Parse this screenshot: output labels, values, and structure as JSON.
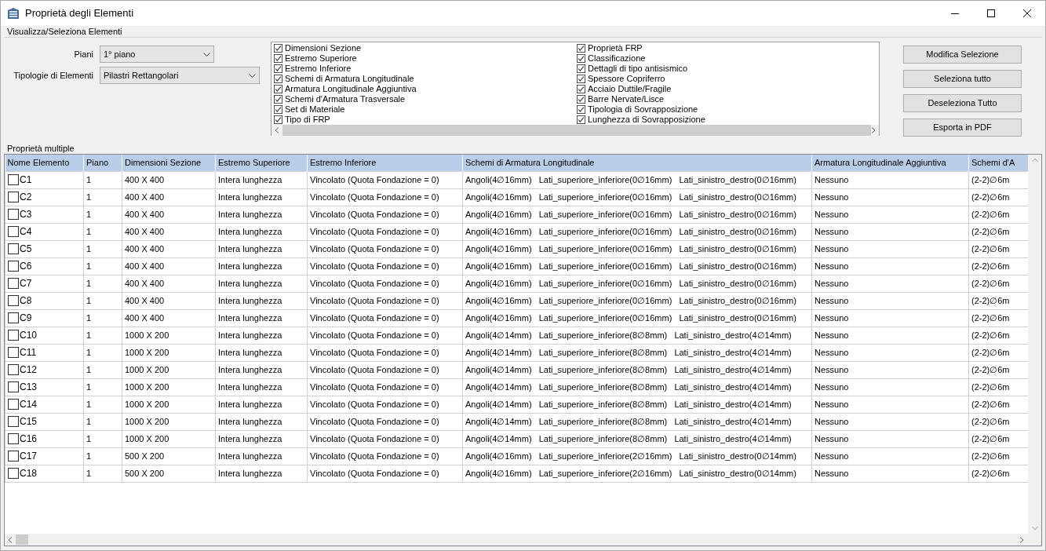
{
  "window": {
    "title": "Proprietà degli Elementi"
  },
  "selection_group": {
    "title": "Visualizza/Seleziona Elementi",
    "fields": [
      {
        "label": "Piani",
        "value": "1° piano"
      },
      {
        "label": "Tipologie di Elementi",
        "value": "Pilastri Rettangolari"
      }
    ],
    "property_checks": [
      {
        "label": "Dimensioni Sezione",
        "checked": true
      },
      {
        "label": "Estremo Superiore",
        "checked": true
      },
      {
        "label": "Estremo Inferiore",
        "checked": true
      },
      {
        "label": "Schemi di Armatura Longitudinale",
        "checked": true
      },
      {
        "label": "Armatura Longitudinale Aggiuntiva",
        "checked": true
      },
      {
        "label": "Schemi d'Armatura Trasversale",
        "checked": true
      },
      {
        "label": "Set di Materiale",
        "checked": true
      },
      {
        "label": "Tipo di FRP",
        "checked": true
      },
      {
        "label": "Proprietà FRP",
        "checked": true
      },
      {
        "label": "Classificazione",
        "checked": true
      },
      {
        "label": "Dettagli di tipo antisismico",
        "checked": true
      },
      {
        "label": "Spessore Copriferro",
        "checked": true
      },
      {
        "label": "Acciaio Duttile/Fragile",
        "checked": true
      },
      {
        "label": "Barre Nervate/Lisce",
        "checked": true
      },
      {
        "label": "Tipologia di Sovrapposizione",
        "checked": true
      },
      {
        "label": "Lunghezza di Sovrapposizione",
        "checked": true
      }
    ],
    "buttons": [
      "Modifica Selezione",
      "Seleziona tutto",
      "Deseleziona Tutto",
      "Esporta in PDF"
    ]
  },
  "table": {
    "title": "Proprietà multiple",
    "columns": [
      "Nome Elemento",
      "Piano",
      "Dimensioni Sezione",
      "Estremo Superiore",
      "Estremo Inferiore",
      "Schemi di Armatura Longitudinale",
      "Armatura Longitudinale Aggiuntiva",
      "Schemi d'A"
    ],
    "rows": [
      {
        "checked": false,
        "cells": [
          "C1",
          "1",
          "400 X 400",
          "Intera lunghezza",
          "Vincolato (Quota Fondazione = 0)",
          "Angoli(4∅16mm)   Lati_superiore_inferiore(0∅16mm)   Lati_sinistro_destro(0∅16mm)",
          "Nessuno",
          "(2-2)∅6m"
        ]
      },
      {
        "checked": false,
        "cells": [
          "C2",
          "1",
          "400 X 400",
          "Intera lunghezza",
          "Vincolato (Quota Fondazione = 0)",
          "Angoli(4∅16mm)   Lati_superiore_inferiore(0∅16mm)   Lati_sinistro_destro(0∅16mm)",
          "Nessuno",
          "(2-2)∅6m"
        ]
      },
      {
        "checked": false,
        "cells": [
          "C3",
          "1",
          "400 X 400",
          "Intera lunghezza",
          "Vincolato (Quota Fondazione = 0)",
          "Angoli(4∅16mm)   Lati_superiore_inferiore(0∅16mm)   Lati_sinistro_destro(0∅16mm)",
          "Nessuno",
          "(2-2)∅6m"
        ]
      },
      {
        "checked": false,
        "cells": [
          "C4",
          "1",
          "400 X 400",
          "Intera lunghezza",
          "Vincolato (Quota Fondazione = 0)",
          "Angoli(4∅16mm)   Lati_superiore_inferiore(0∅16mm)   Lati_sinistro_destro(0∅16mm)",
          "Nessuno",
          "(2-2)∅6m"
        ]
      },
      {
        "checked": false,
        "cells": [
          "C5",
          "1",
          "400 X 400",
          "Intera lunghezza",
          "Vincolato (Quota Fondazione = 0)",
          "Angoli(4∅16mm)   Lati_superiore_inferiore(0∅16mm)   Lati_sinistro_destro(0∅16mm)",
          "Nessuno",
          "(2-2)∅6m"
        ]
      },
      {
        "checked": false,
        "cells": [
          "C6",
          "1",
          "400 X 400",
          "Intera lunghezza",
          "Vincolato (Quota Fondazione = 0)",
          "Angoli(4∅16mm)   Lati_superiore_inferiore(0∅16mm)   Lati_sinistro_destro(0∅16mm)",
          "Nessuno",
          "(2-2)∅6m"
        ]
      },
      {
        "checked": false,
        "cells": [
          "C7",
          "1",
          "400 X 400",
          "Intera lunghezza",
          "Vincolato (Quota Fondazione = 0)",
          "Angoli(4∅16mm)   Lati_superiore_inferiore(0∅16mm)   Lati_sinistro_destro(0∅16mm)",
          "Nessuno",
          "(2-2)∅6m"
        ]
      },
      {
        "checked": false,
        "cells": [
          "C8",
          "1",
          "400 X 400",
          "Intera lunghezza",
          "Vincolato (Quota Fondazione = 0)",
          "Angoli(4∅16mm)   Lati_superiore_inferiore(0∅16mm)   Lati_sinistro_destro(0∅16mm)",
          "Nessuno",
          "(2-2)∅6m"
        ]
      },
      {
        "checked": false,
        "cells": [
          "C9",
          "1",
          "400 X 400",
          "Intera lunghezza",
          "Vincolato (Quota Fondazione = 0)",
          "Angoli(4∅16mm)   Lati_superiore_inferiore(0∅16mm)   Lati_sinistro_destro(0∅16mm)",
          "Nessuno",
          "(2-2)∅6m"
        ]
      },
      {
        "checked": false,
        "cells": [
          "C10",
          "1",
          "1000 X 200",
          "Intera lunghezza",
          "Vincolato (Quota Fondazione = 0)",
          "Angoli(4∅14mm)   Lati_superiore_inferiore(8∅8mm)   Lati_sinistro_destro(4∅14mm)",
          "Nessuno",
          "(2-2)∅6m"
        ]
      },
      {
        "checked": false,
        "cells": [
          "C11",
          "1",
          "1000 X 200",
          "Intera lunghezza",
          "Vincolato (Quota Fondazione = 0)",
          "Angoli(4∅14mm)   Lati_superiore_inferiore(8∅8mm)   Lati_sinistro_destro(4∅14mm)",
          "Nessuno",
          "(2-2)∅6m"
        ]
      },
      {
        "checked": false,
        "cells": [
          "C12",
          "1",
          "1000 X 200",
          "Intera lunghezza",
          "Vincolato (Quota Fondazione = 0)",
          "Angoli(4∅14mm)   Lati_superiore_inferiore(8∅8mm)   Lati_sinistro_destro(4∅14mm)",
          "Nessuno",
          "(2-2)∅6m"
        ]
      },
      {
        "checked": false,
        "cells": [
          "C13",
          "1",
          "1000 X 200",
          "Intera lunghezza",
          "Vincolato (Quota Fondazione = 0)",
          "Angoli(4∅14mm)   Lati_superiore_inferiore(8∅8mm)   Lati_sinistro_destro(4∅14mm)",
          "Nessuno",
          "(2-2)∅6m"
        ]
      },
      {
        "checked": false,
        "cells": [
          "C14",
          "1",
          "1000 X 200",
          "Intera lunghezza",
          "Vincolato (Quota Fondazione = 0)",
          "Angoli(4∅14mm)   Lati_superiore_inferiore(8∅8mm)   Lati_sinistro_destro(4∅14mm)",
          "Nessuno",
          "(2-2)∅6m"
        ]
      },
      {
        "checked": false,
        "cells": [
          "C15",
          "1",
          "1000 X 200",
          "Intera lunghezza",
          "Vincolato (Quota Fondazione = 0)",
          "Angoli(4∅14mm)   Lati_superiore_inferiore(8∅8mm)   Lati_sinistro_destro(4∅14mm)",
          "Nessuno",
          "(2-2)∅6m"
        ]
      },
      {
        "checked": false,
        "cells": [
          "C16",
          "1",
          "1000 X 200",
          "Intera lunghezza",
          "Vincolato (Quota Fondazione = 0)",
          "Angoli(4∅14mm)   Lati_superiore_inferiore(8∅8mm)   Lati_sinistro_destro(4∅14mm)",
          "Nessuno",
          "(2-2)∅6m"
        ]
      },
      {
        "checked": false,
        "cells": [
          "C17",
          "1",
          "500 X 200",
          "Intera lunghezza",
          "Vincolato (Quota Fondazione = 0)",
          "Angoli(4∅16mm)   Lati_superiore_inferiore(2∅16mm)   Lati_sinistro_destro(0∅14mm)",
          "Nessuno",
          "(2-2)∅6m"
        ]
      },
      {
        "checked": false,
        "cells": [
          "C18",
          "1",
          "500 X 200",
          "Intera lunghezza",
          "Vincolato (Quota Fondazione = 0)",
          "Angoli(4∅16mm)   Lati_superiore_inferiore(2∅16mm)   Lati_sinistro_destro(0∅14mm)",
          "Nessuno",
          "(2-2)∅6m"
        ]
      }
    ]
  }
}
